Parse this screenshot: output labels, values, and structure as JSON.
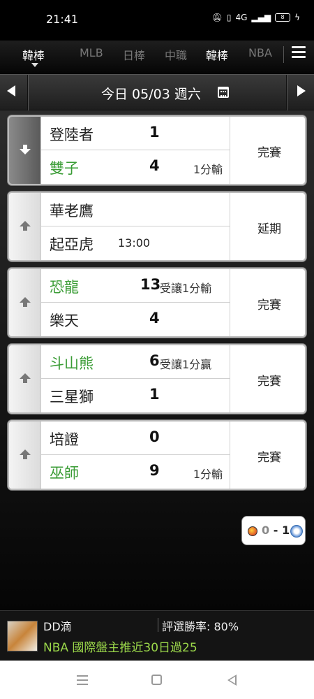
{
  "status_bar": {
    "time": "21:41",
    "icons": [
      "mute-icon",
      "volte-icon",
      "signal-icon"
    ],
    "network": "4G",
    "battery": "8"
  },
  "league_tabs": {
    "active": "韓棒",
    "items": [
      {
        "label": "韓棒",
        "active": true
      },
      {
        "label": "MLB",
        "active": false
      },
      {
        "label": "日棒",
        "active": false
      },
      {
        "label": "中職",
        "active": false
      },
      {
        "label": "韓棒",
        "active": false
      },
      {
        "label": "NBA",
        "active": false
      }
    ]
  },
  "date_bar": {
    "label": "今日 05/03 週六"
  },
  "games": [
    {
      "status": "完賽",
      "expanded": true,
      "home": {
        "name": "登陸者",
        "score": "1",
        "note": "",
        "winner": false
      },
      "away": {
        "name": "雙子",
        "score": "4",
        "note": "1分輸",
        "winner": true
      }
    },
    {
      "status": "延期",
      "expanded": false,
      "home": {
        "name": "華老鷹",
        "score": "",
        "note": "",
        "winner": false
      },
      "away": {
        "name": "起亞虎",
        "score": "",
        "time": "13:00",
        "winner": false
      }
    },
    {
      "status": "完賽",
      "expanded": false,
      "home": {
        "name": "恐龍",
        "score": "13",
        "note": "受讓1分輸",
        "winner": true
      },
      "away": {
        "name": "樂天",
        "score": "4",
        "note": "",
        "winner": false
      }
    },
    {
      "status": "完賽",
      "expanded": false,
      "home": {
        "name": "斗山熊",
        "score": "6",
        "note": "受讓1分贏",
        "winner": true
      },
      "away": {
        "name": "三星獅",
        "score": "1",
        "note": "",
        "winner": false
      }
    },
    {
      "status": "完賽",
      "expanded": false,
      "home": {
        "name": "培證",
        "score": "0",
        "note": "",
        "winner": false
      },
      "away": {
        "name": "巫師",
        "score": "9",
        "note": "1分輸",
        "winner": true
      }
    }
  ],
  "score_bubble": {
    "score_a": "0",
    "separator": "-",
    "score_b": "1"
  },
  "ad": {
    "name": "DD滴",
    "rate": "評選勝率: 80%",
    "headline": "NBA 國際盤主推近30日過25"
  },
  "colors": {
    "winner_green": "#3a9c35",
    "headline_green": "#9bd84a"
  }
}
